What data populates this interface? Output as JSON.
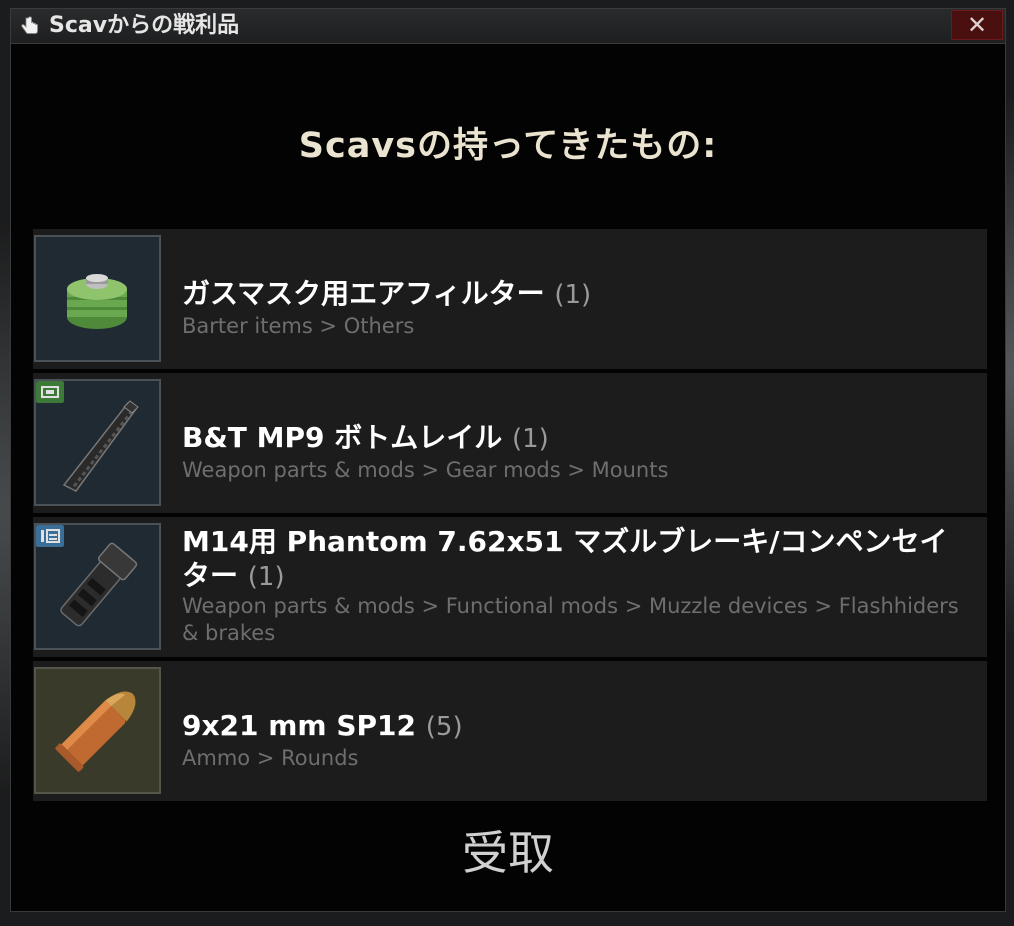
{
  "window": {
    "title": "Scavからの戦利品",
    "close_label": "✕"
  },
  "heading": "Scavsの持ってきたもの:",
  "items": [
    {
      "name": "ガスマスク用エアフィルター",
      "qty": "(1)",
      "category": "Barter items > Others",
      "icon": "gas-filter-icon"
    },
    {
      "name": "B&T MP9 ボトムレイル",
      "qty": "(1)",
      "category": "Weapon parts & mods > Gear mods > Mounts",
      "icon": "bottom-rail-icon"
    },
    {
      "name": "M14用 Phantom 7.62x51 マズルブレーキ/コンペンセイター",
      "qty": "(1)",
      "category": "Weapon parts & mods > Functional mods > Muzzle devices > Flashhiders & brakes",
      "icon": "muzzle-brake-icon"
    },
    {
      "name": "9x21 mm SP12",
      "qty": "(5)",
      "category": "Ammo > Rounds",
      "icon": "ammo-round-icon"
    }
  ],
  "accept_label": "受取",
  "colors": {
    "window_bg": "#030303",
    "row_bg": "#1c1c1c",
    "heading": "#e9e3cf",
    "category_text": "#6e6e6e",
    "close_bg": "#4a1010"
  }
}
